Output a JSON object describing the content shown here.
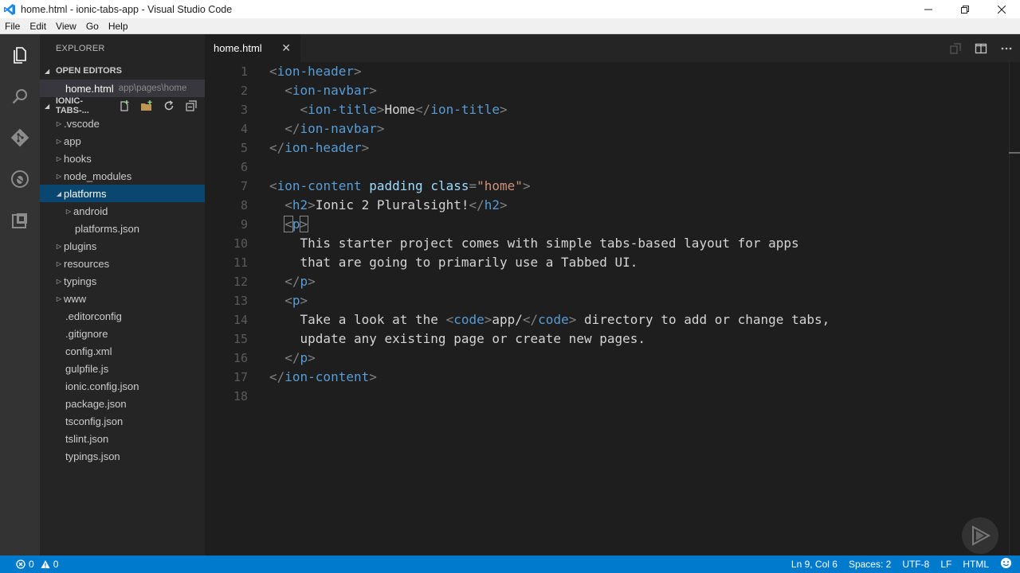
{
  "window": {
    "title": "home.html - ionic-tabs-app - Visual Studio Code",
    "controls": [
      "minimize",
      "restore",
      "close"
    ]
  },
  "menu": [
    "File",
    "Edit",
    "View",
    "Go",
    "Help"
  ],
  "activity_bar": {
    "icons": [
      "explorer-icon",
      "search-icon",
      "git-icon",
      "debug-icon",
      "extensions-icon"
    ]
  },
  "sidebar": {
    "title": "EXPLORER",
    "open_editors_label": "OPEN EDITORS",
    "open_editor": {
      "name": "home.html",
      "path": "app\\pages\\home"
    },
    "project_label": "IONIC-TABS-...",
    "tree": [
      {
        "label": ".vscode",
        "type": "folder"
      },
      {
        "label": "app",
        "type": "folder"
      },
      {
        "label": "hooks",
        "type": "folder"
      },
      {
        "label": "node_modules",
        "type": "folder"
      },
      {
        "label": "platforms",
        "type": "folder-open",
        "selected": true
      },
      {
        "label": "android",
        "type": "folder",
        "child": true
      },
      {
        "label": "platforms.json",
        "type": "file",
        "child": true
      },
      {
        "label": "plugins",
        "type": "folder"
      },
      {
        "label": "resources",
        "type": "folder"
      },
      {
        "label": "typings",
        "type": "folder"
      },
      {
        "label": "www",
        "type": "folder"
      },
      {
        "label": ".editorconfig",
        "type": "file"
      },
      {
        "label": ".gitignore",
        "type": "file"
      },
      {
        "label": "config.xml",
        "type": "file"
      },
      {
        "label": "gulpfile.js",
        "type": "file"
      },
      {
        "label": "ionic.config.json",
        "type": "file"
      },
      {
        "label": "package.json",
        "type": "file"
      },
      {
        "label": "tsconfig.json",
        "type": "file"
      },
      {
        "label": "tslint.json",
        "type": "file"
      },
      {
        "label": "typings.json",
        "type": "file"
      }
    ]
  },
  "editor": {
    "tab_label": "home.html",
    "lines": [
      [
        [
          "b",
          "<"
        ],
        [
          "tag",
          "ion-header"
        ],
        [
          "b",
          ">"
        ]
      ],
      [
        [
          "t",
          "  "
        ],
        [
          "b",
          "<"
        ],
        [
          "tag",
          "ion-navbar"
        ],
        [
          "b",
          ">"
        ]
      ],
      [
        [
          "t",
          "    "
        ],
        [
          "b",
          "<"
        ],
        [
          "tag",
          "ion-title"
        ],
        [
          "b",
          ">"
        ],
        [
          "t",
          "Home"
        ],
        [
          "b",
          "</"
        ],
        [
          "tag",
          "ion-title"
        ],
        [
          "b",
          ">"
        ]
      ],
      [
        [
          "t",
          "  "
        ],
        [
          "b",
          "</"
        ],
        [
          "tag",
          "ion-navbar"
        ],
        [
          "b",
          ">"
        ]
      ],
      [
        [
          "b",
          "</"
        ],
        [
          "tag",
          "ion-header"
        ],
        [
          "b",
          ">"
        ]
      ],
      [],
      [
        [
          "b",
          "<"
        ],
        [
          "tag",
          "ion-content"
        ],
        [
          "t",
          " "
        ],
        [
          "attr",
          "padding"
        ],
        [
          "t",
          " "
        ],
        [
          "attr",
          "class"
        ],
        [
          "b",
          "="
        ],
        [
          "str",
          "\"home\""
        ],
        [
          "b",
          ">"
        ]
      ],
      [
        [
          "t",
          "  "
        ],
        [
          "b",
          "<"
        ],
        [
          "tag",
          "h2"
        ],
        [
          "b",
          ">"
        ],
        [
          "t",
          "Ionic 2 Pluralsight!"
        ],
        [
          "b",
          "</"
        ],
        [
          "tag",
          "h2"
        ],
        [
          "b",
          ">"
        ]
      ],
      [
        [
          "t",
          "  "
        ],
        [
          "bm",
          "<"
        ],
        [
          "tag",
          "p"
        ],
        [
          "bm",
          ">"
        ]
      ],
      [
        [
          "t",
          "    This starter project comes with simple tabs-based layout for apps"
        ]
      ],
      [
        [
          "t",
          "    that are going to primarily use a Tabbed UI."
        ]
      ],
      [
        [
          "t",
          "  "
        ],
        [
          "b",
          "</"
        ],
        [
          "tag",
          "p"
        ],
        [
          "b",
          ">"
        ]
      ],
      [
        [
          "t",
          "  "
        ],
        [
          "b",
          "<"
        ],
        [
          "tag",
          "p"
        ],
        [
          "b",
          ">"
        ]
      ],
      [
        [
          "t",
          "    Take a look at the "
        ],
        [
          "b",
          "<"
        ],
        [
          "tag",
          "code"
        ],
        [
          "b",
          ">"
        ],
        [
          "t",
          "app/"
        ],
        [
          "b",
          "</"
        ],
        [
          "tag",
          "code"
        ],
        [
          "b",
          ">"
        ],
        [
          "t",
          " directory to add or change tabs,"
        ]
      ],
      [
        [
          "t",
          "    update any existing page or create new pages."
        ]
      ],
      [
        [
          "t",
          "  "
        ],
        [
          "b",
          "</"
        ],
        [
          "tag",
          "p"
        ],
        [
          "b",
          ">"
        ]
      ],
      [
        [
          "b",
          "</"
        ],
        [
          "tag",
          "ion-content"
        ],
        [
          "b",
          ">"
        ]
      ],
      []
    ]
  },
  "status": {
    "errors": "0",
    "warnings": "0",
    "position": "Ln 9, Col 6",
    "spaces": "Spaces: 2",
    "encoding": "UTF-8",
    "eol": "LF",
    "language": "HTML"
  },
  "colors": {
    "accent": "#007acc",
    "selection": "#094771",
    "tag": "#569cd6",
    "attr": "#9cdcfe",
    "string": "#ce9178"
  }
}
